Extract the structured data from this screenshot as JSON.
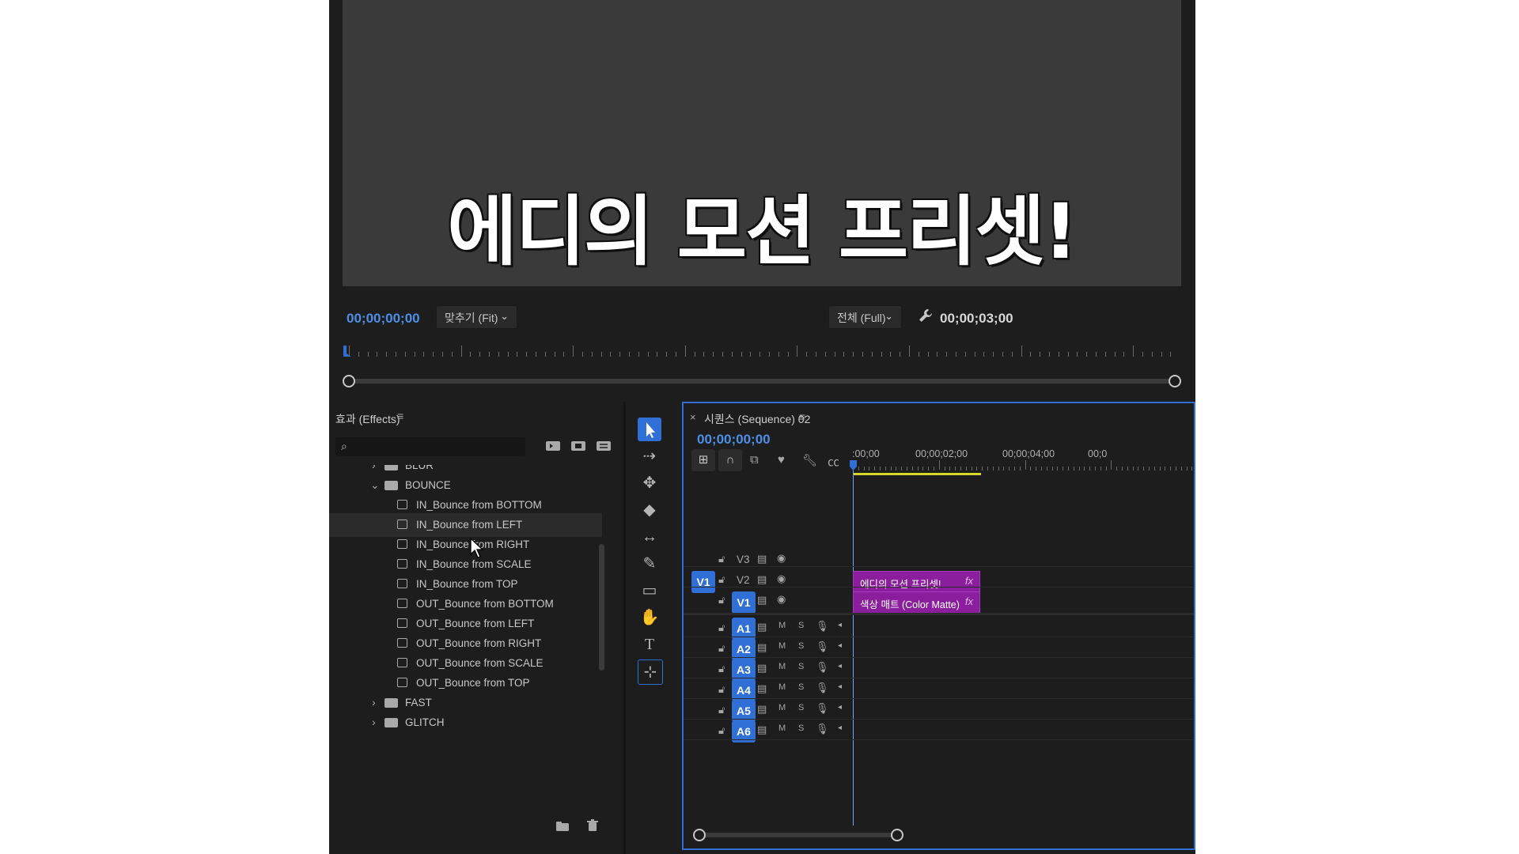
{
  "monitor": {
    "overlay_title": "에디의 모션 프리셋!",
    "current_timecode": "00;00;00;00",
    "zoom_dropdown": "맞추기 (Fit)",
    "resolution_dropdown": "전체 (Full)",
    "duration_timecode": "00;00;03;00"
  },
  "effects_panel": {
    "title": "효과 (Effects)",
    "search_placeholder": "",
    "items": [
      {
        "label": "BLUR",
        "type": "folder",
        "expanded": false
      },
      {
        "label": "BOUNCE",
        "type": "folder",
        "expanded": true
      },
      {
        "label": "IN_Bounce from BOTTOM",
        "type": "preset"
      },
      {
        "label": "IN_Bounce from LEFT",
        "type": "preset",
        "selected": true
      },
      {
        "label": "IN_Bounce from RIGHT",
        "type": "preset"
      },
      {
        "label": "IN_Bounce from SCALE",
        "type": "preset"
      },
      {
        "label": "IN_Bounce from TOP",
        "type": "preset"
      },
      {
        "label": "OUT_Bounce from BOTTOM",
        "type": "preset"
      },
      {
        "label": "OUT_Bounce from LEFT",
        "type": "preset"
      },
      {
        "label": "OUT_Bounce from RIGHT",
        "type": "preset"
      },
      {
        "label": "OUT_Bounce from SCALE",
        "type": "preset"
      },
      {
        "label": "OUT_Bounce from TOP",
        "type": "preset"
      },
      {
        "label": "FAST",
        "type": "folder",
        "expanded": false
      },
      {
        "label": "GLITCH",
        "type": "folder",
        "expanded": false
      }
    ]
  },
  "timeline": {
    "title": "시퀀스 (Sequence) 02",
    "close_symbol": "×",
    "timecode": "00;00;00;00",
    "ruler_labels": [
      ":00;00",
      "00;00;02;00",
      "00;00;04;00",
      "00;0"
    ],
    "source_patch": "V1",
    "video_tracks": [
      "V3",
      "V2",
      "V1"
    ],
    "audio_tracks": [
      "A1",
      "A2",
      "A3",
      "A4",
      "A5",
      "A6"
    ],
    "audio_buttons": {
      "mute": "M",
      "solo": "S"
    },
    "clips": [
      {
        "name": "에디의 모션 프리셋!",
        "track": "V2",
        "fx": "fx"
      },
      {
        "name": "색상 매트 (Color Matte)",
        "track": "V1",
        "fx": "fx"
      }
    ]
  },
  "colors": {
    "accent": "#2f6fd6",
    "timecode_blue": "#4d8fe6",
    "clip_purple": "#8a1e9c",
    "work_area_yellow": "#d6d62a"
  }
}
